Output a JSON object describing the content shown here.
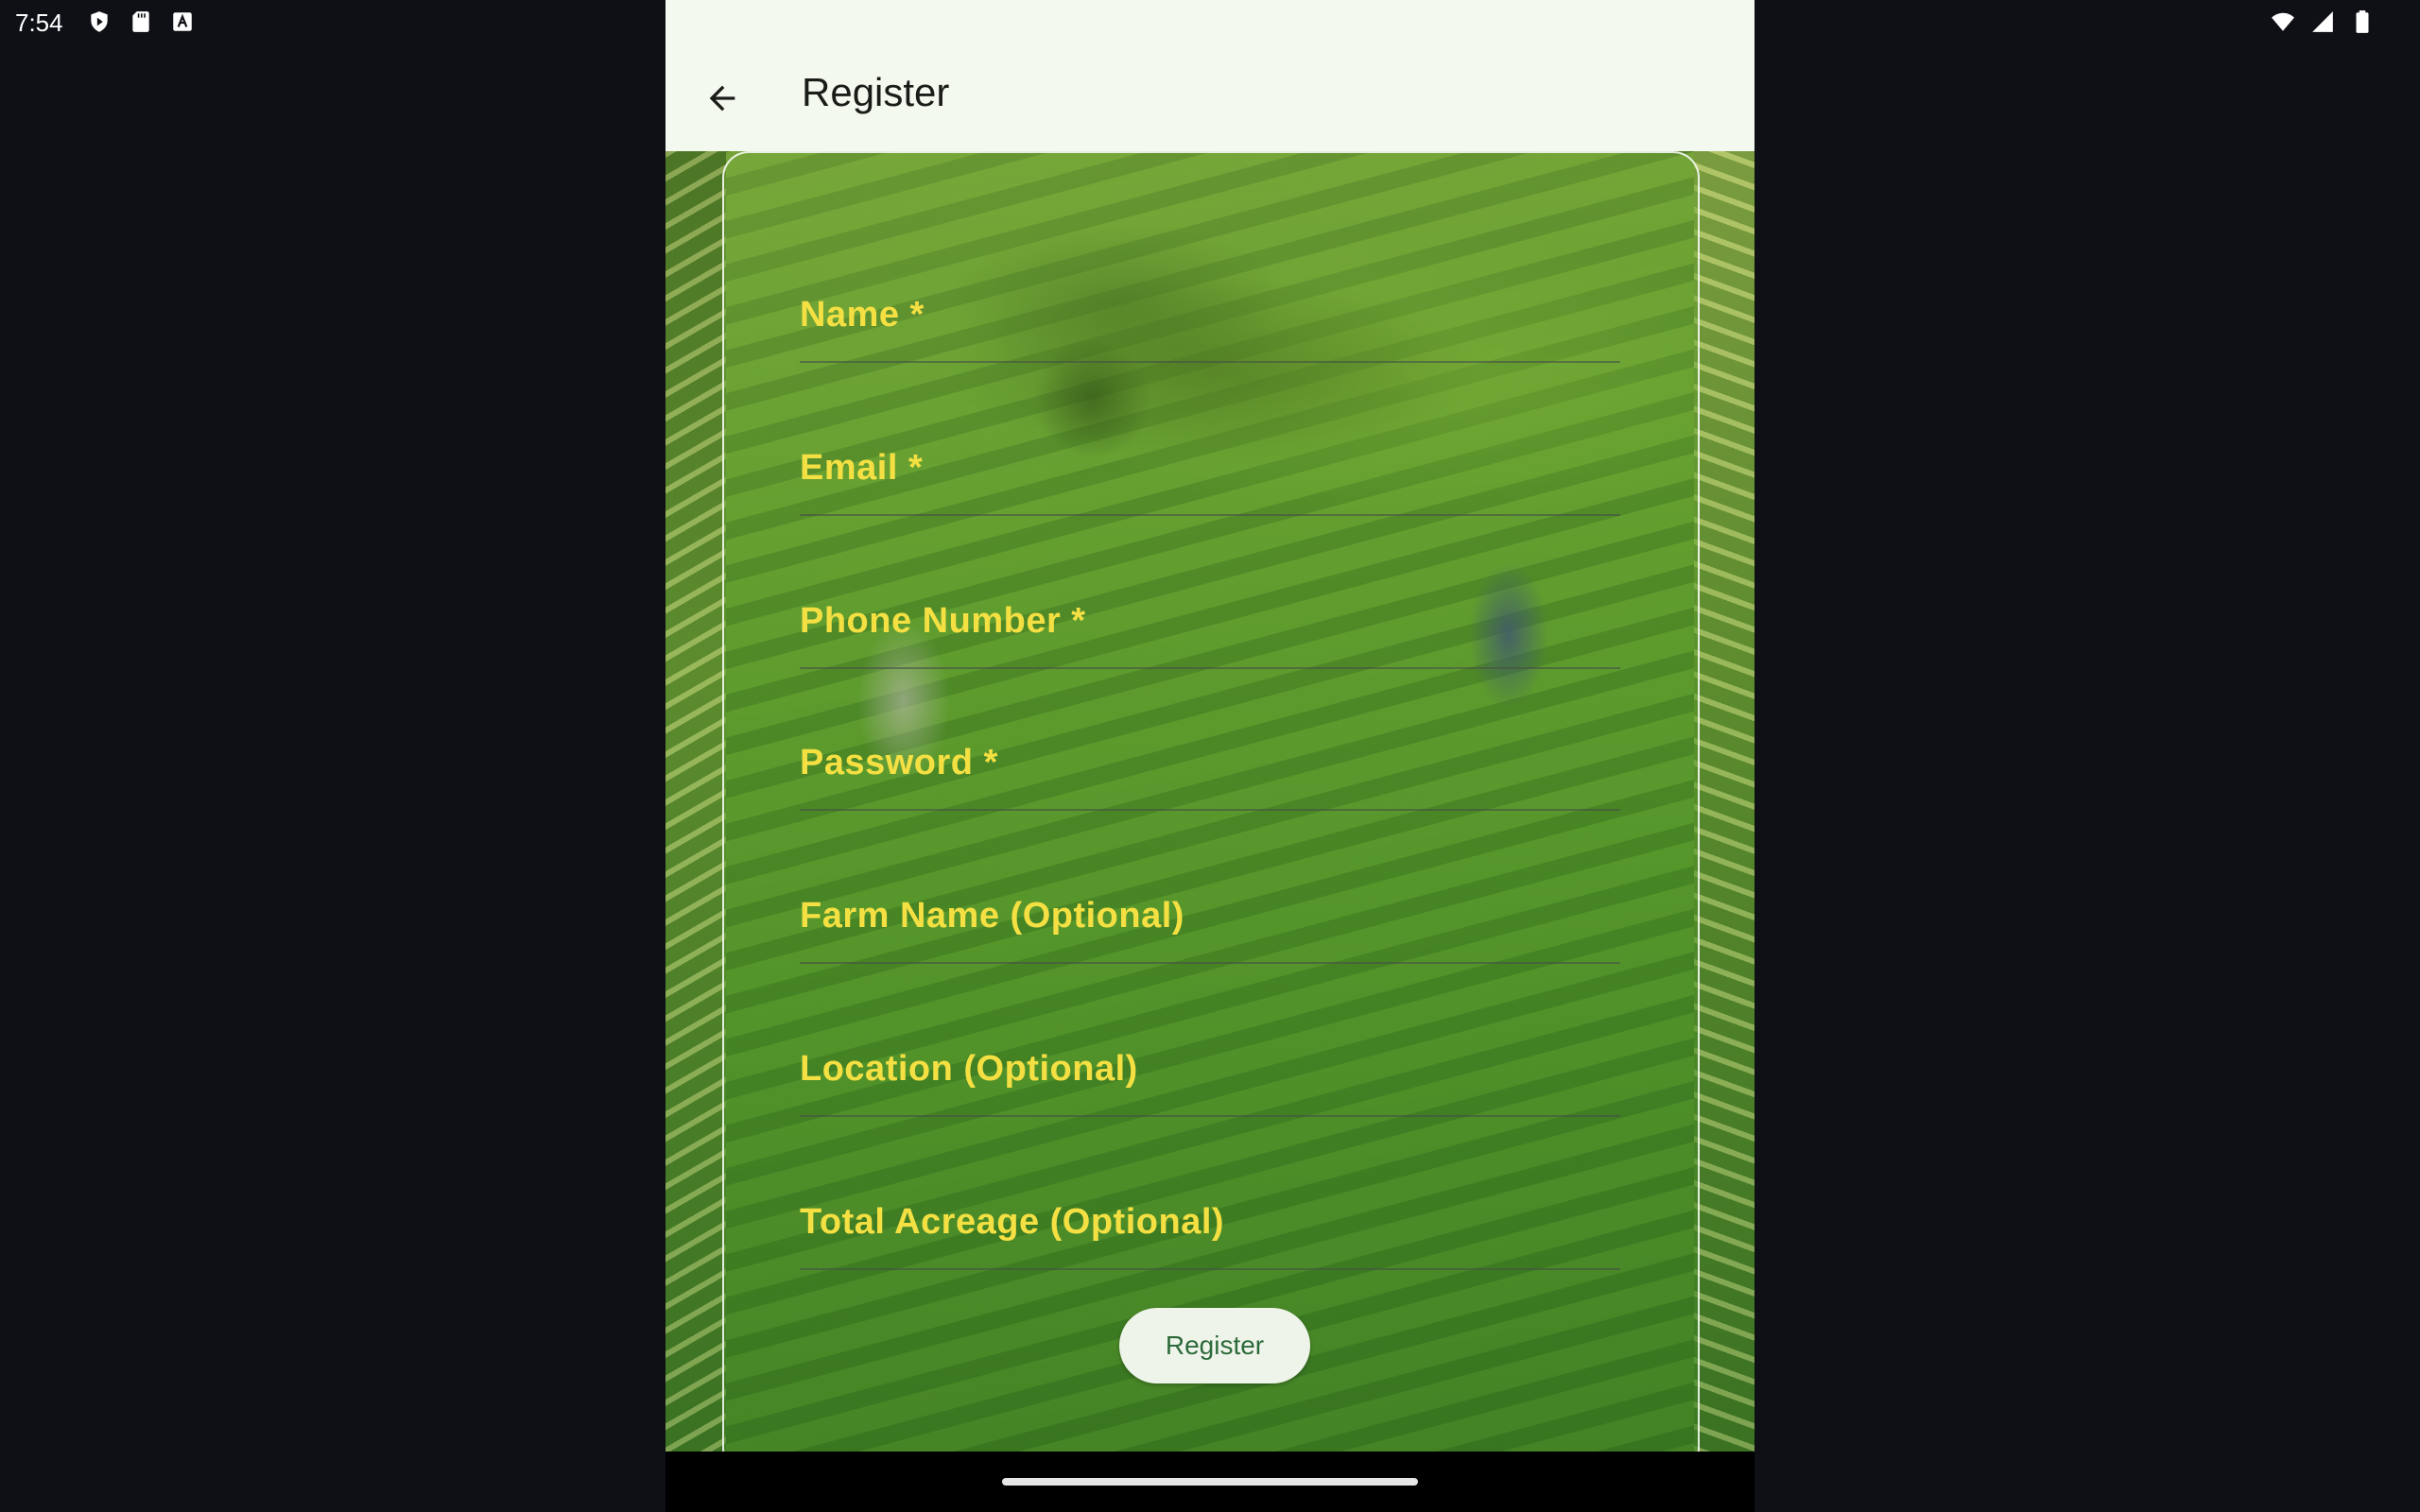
{
  "status_bar": {
    "time": "7:54",
    "left_icons": [
      "shield-play-icon",
      "sd-card-icon",
      "keyboard-a-icon"
    ],
    "right_icons": [
      "wifi-icon",
      "cell-signal-icon",
      "battery-icon"
    ]
  },
  "app_bar": {
    "back_icon": "arrow-back-icon",
    "title": "Register"
  },
  "form": {
    "fields": [
      {
        "label": "Name *"
      },
      {
        "label": "Email *"
      },
      {
        "label": "Phone Number *"
      },
      {
        "label": "Password *"
      },
      {
        "label": "Farm Name (Optional)"
      },
      {
        "label": "Location (Optional)"
      },
      {
        "label": "Total Acreage (Optional)"
      }
    ],
    "submit_label": "Register"
  },
  "colors": {
    "label_yellow": "#f5e043",
    "app_bar_bg": "#f4f9f0",
    "button_text": "#2c6a3a"
  }
}
